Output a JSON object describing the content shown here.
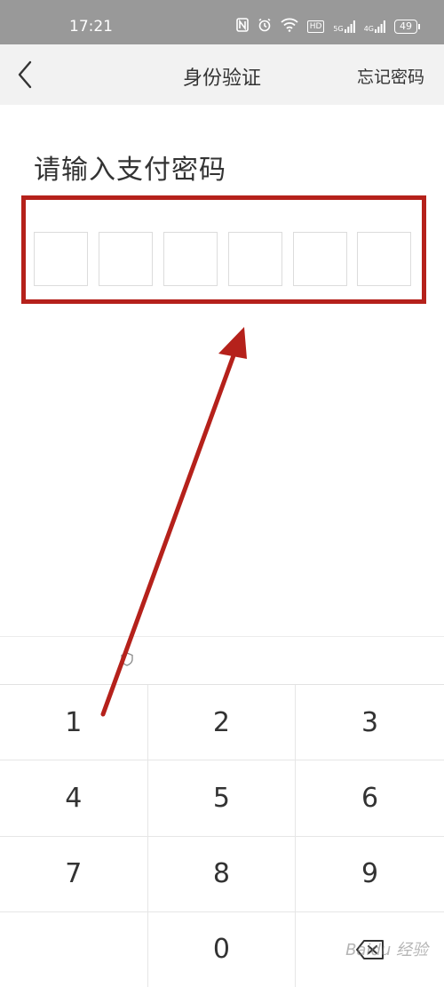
{
  "status_bar": {
    "time": "17:21",
    "hd": "HD",
    "net1": "5G",
    "net2": "4G",
    "battery": "49"
  },
  "nav": {
    "title": "身份验证",
    "forgot": "忘记密码"
  },
  "prompt": {
    "title": "请输入支付密码"
  },
  "pin": {
    "length": 6,
    "digits": [
      "",
      "",
      "",
      "",
      "",
      ""
    ]
  },
  "keypad": {
    "keys": [
      "1",
      "2",
      "3",
      "4",
      "5",
      "6",
      "7",
      "8",
      "9",
      "",
      "0",
      "delete"
    ]
  },
  "colors": {
    "highlight": "#b5211b",
    "nav_bg": "#f2f2f2",
    "status_bg": "#999999"
  },
  "watermark": "Baidu 经验"
}
